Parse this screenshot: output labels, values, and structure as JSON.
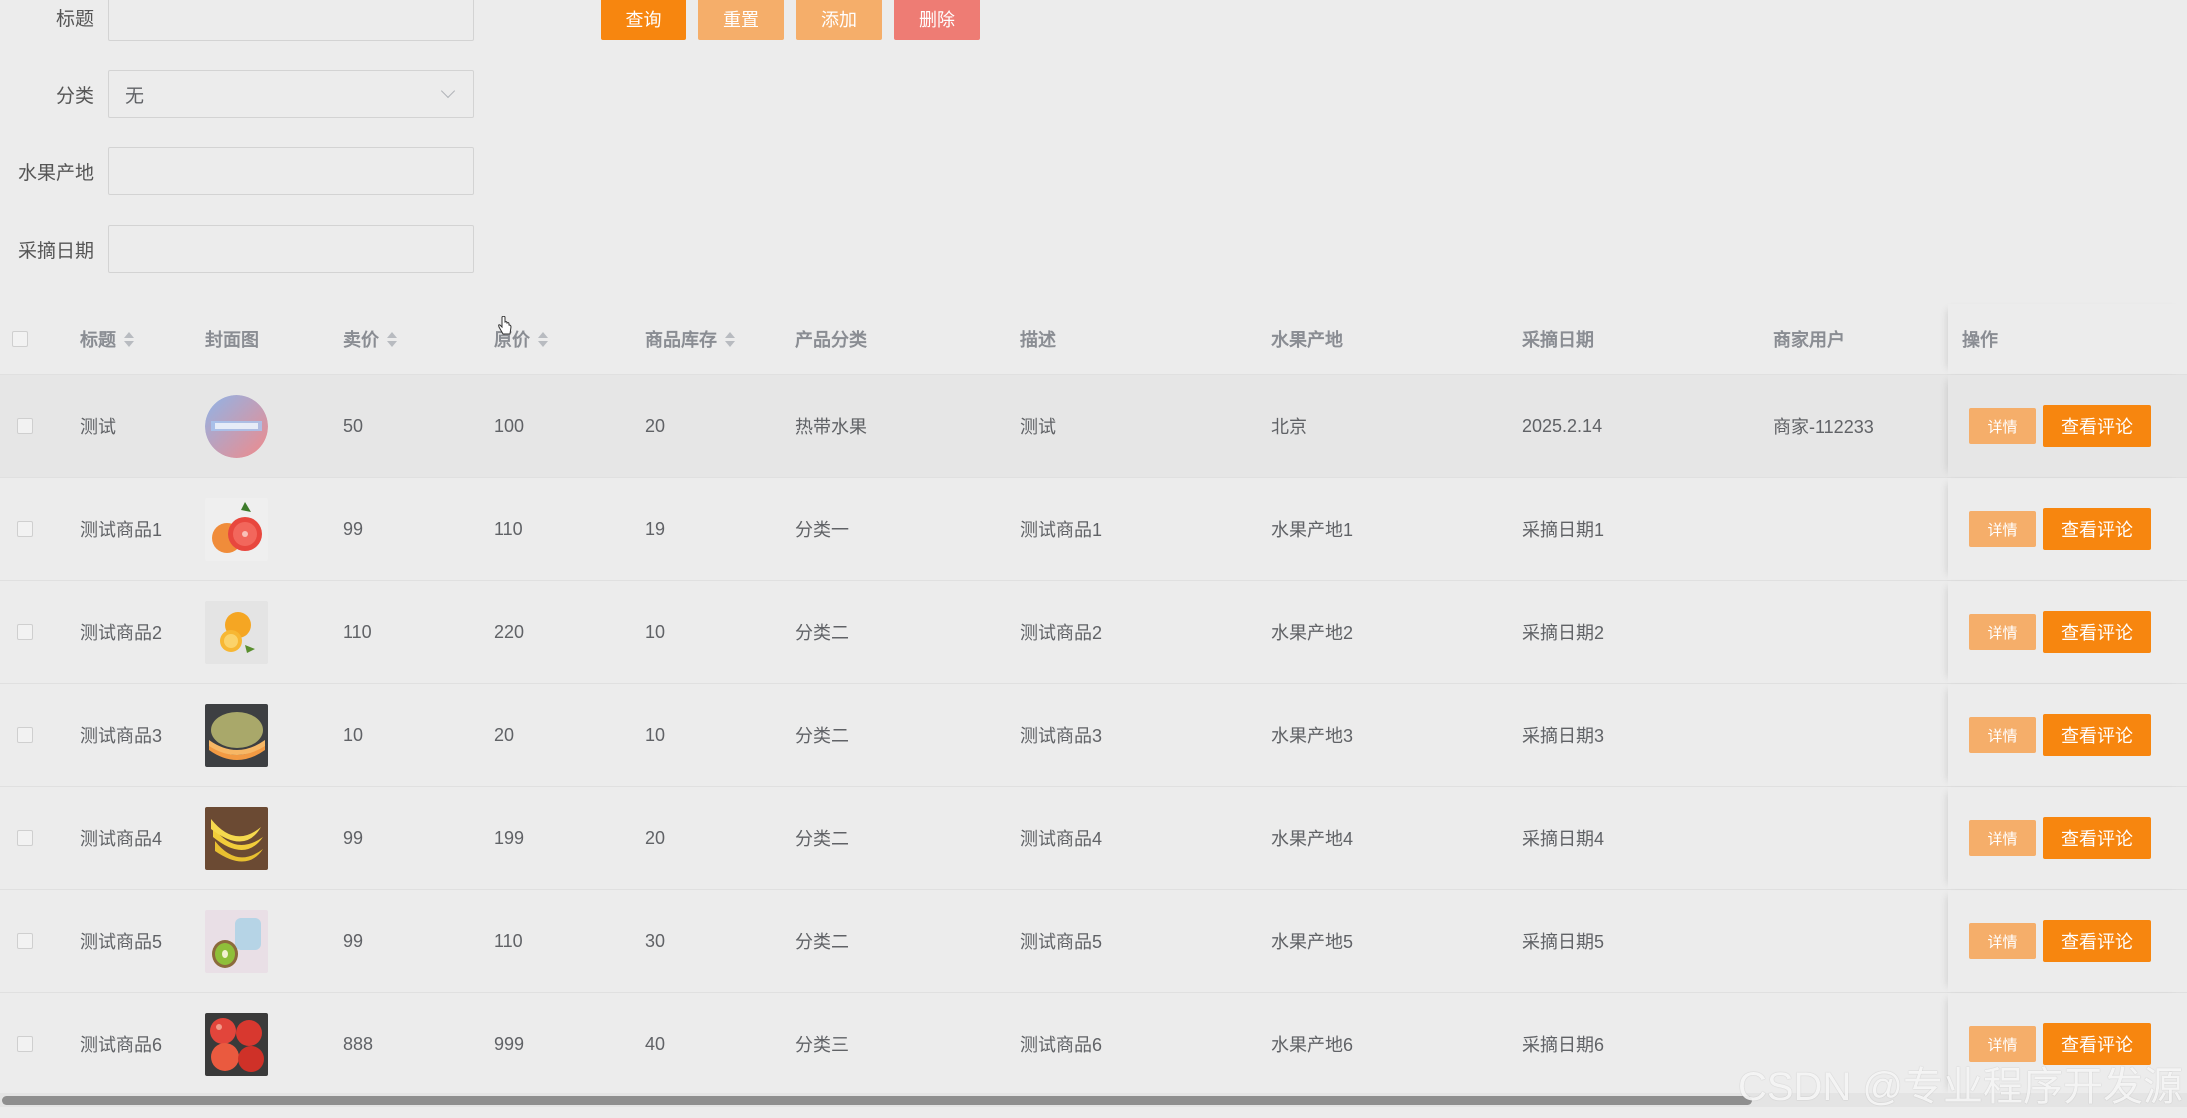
{
  "form": {
    "title_label": "标题",
    "title_value": "",
    "category_label": "分类",
    "category_value": "无",
    "origin_label": "水果产地",
    "origin_value": "",
    "pick_date_label": "采摘日期",
    "pick_date_value": ""
  },
  "toolbar": {
    "search_label": "查询",
    "reset_label": "重置",
    "add_label": "添加",
    "delete_label": "删除"
  },
  "table": {
    "headers": {
      "title": "标题",
      "cover": "封面图",
      "price": "卖价",
      "orig_price": "原价",
      "stock": "商品库存",
      "category": "产品分类",
      "desc": "描述",
      "origin": "水果产地",
      "pick_date": "采摘日期",
      "merchant": "商家用户",
      "ops": "操作"
    },
    "rows": [
      {
        "title": "测试",
        "cover_icon": "test-product-image",
        "price": "50",
        "orig_price": "100",
        "stock": "20",
        "category": "热带水果",
        "desc": "测试",
        "origin": "北京",
        "pick_date": "2025.2.14",
        "merchant": "商家-112233",
        "detail_label": "详情",
        "comment_label": "查看评论"
      },
      {
        "title": "测试商品1",
        "cover_icon": "grapefruit-image",
        "price": "99",
        "orig_price": "110",
        "stock": "19",
        "category": "分类一",
        "desc": "测试商品1",
        "origin": "水果产地1",
        "pick_date": "采摘日期1",
        "merchant": "",
        "detail_label": "详情",
        "comment_label": "查看评论"
      },
      {
        "title": "测试商品2",
        "cover_icon": "orange-image",
        "price": "110",
        "orig_price": "220",
        "stock": "10",
        "category": "分类二",
        "desc": "测试商品2",
        "origin": "水果产地2",
        "pick_date": "采摘日期2",
        "merchant": "",
        "detail_label": "详情",
        "comment_label": "查看评论"
      },
      {
        "title": "测试商品3",
        "cover_icon": "melon-image",
        "price": "10",
        "orig_price": "20",
        "stock": "10",
        "category": "分类二",
        "desc": "测试商品3",
        "origin": "水果产地3",
        "pick_date": "采摘日期3",
        "merchant": "",
        "detail_label": "详情",
        "comment_label": "查看评论"
      },
      {
        "title": "测试商品4",
        "cover_icon": "banana-image",
        "price": "99",
        "orig_price": "199",
        "stock": "20",
        "category": "分类二",
        "desc": "测试商品4",
        "origin": "水果产地4",
        "pick_date": "采摘日期4",
        "merchant": "",
        "detail_label": "详情",
        "comment_label": "查看评论"
      },
      {
        "title": "测试商品5",
        "cover_icon": "kiwi-image",
        "price": "99",
        "orig_price": "110",
        "stock": "30",
        "category": "分类二",
        "desc": "测试商品5",
        "origin": "水果产地5",
        "pick_date": "采摘日期5",
        "merchant": "",
        "detail_label": "详情",
        "comment_label": "查看评论"
      },
      {
        "title": "测试商品6",
        "cover_icon": "apple-image",
        "price": "888",
        "orig_price": "999",
        "stock": "40",
        "category": "分类三",
        "desc": "测试商品6",
        "origin": "水果产地6",
        "pick_date": "采摘日期6",
        "merchant": "",
        "detail_label": "详情",
        "comment_label": "查看评论"
      }
    ]
  },
  "watermark": "CSDN @专业程序开发源",
  "colors": {
    "primary": "#f7860f",
    "secondary": "#f5ae6a",
    "danger": "#ee7c74",
    "background": "#ececec"
  }
}
